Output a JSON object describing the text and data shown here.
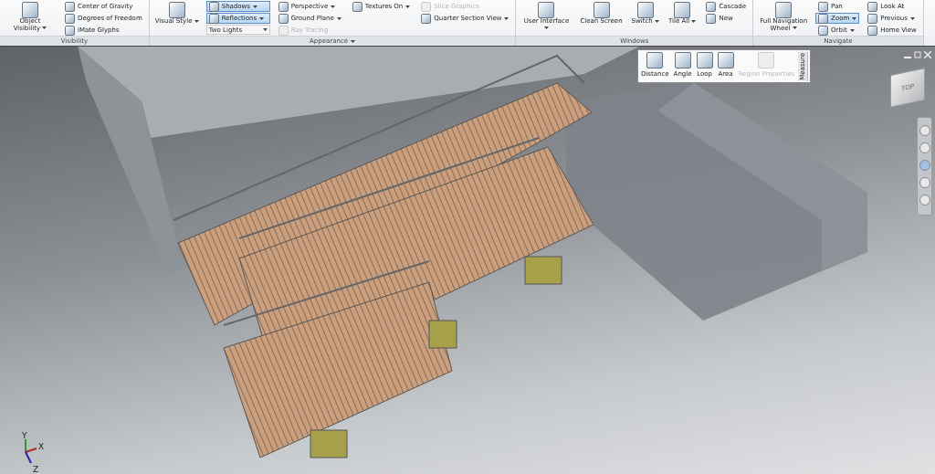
{
  "ribbon": {
    "panels": [
      {
        "label": "Visibility",
        "menu": false,
        "columns": [
          [
            {
              "kind": "large",
              "label": "Object Visibility",
              "menu": true,
              "selected": false,
              "disabled": false
            }
          ],
          [
            {
              "kind": "small",
              "label": "Center of Gravity",
              "menu": false,
              "selected": false,
              "disabled": false
            },
            {
              "kind": "small",
              "label": "Degrees of Freedom",
              "menu": false,
              "selected": false,
              "disabled": false
            },
            {
              "kind": "small",
              "label": "iMate Glyphs",
              "menu": false,
              "selected": false,
              "disabled": false
            }
          ]
        ]
      },
      {
        "label": "Appearance",
        "menu": true,
        "columns": [
          [
            {
              "kind": "large",
              "label": "Visual Style",
              "menu": true,
              "selected": false,
              "disabled": false
            }
          ],
          [
            {
              "kind": "small",
              "label": "Shadows",
              "menu": true,
              "selected": true,
              "disabled": false
            },
            {
              "kind": "small",
              "label": "Reflections",
              "menu": true,
              "selected": true,
              "disabled": false
            },
            {
              "kind": "combo",
              "label": "Two Lights",
              "menu": true
            }
          ],
          [
            {
              "kind": "small",
              "label": "Perspective",
              "menu": true,
              "selected": false,
              "disabled": false
            },
            {
              "kind": "small",
              "label": "Ground Plane",
              "menu": true,
              "selected": false,
              "disabled": false
            },
            {
              "kind": "small",
              "label": "Ray Tracing",
              "menu": false,
              "selected": false,
              "disabled": true
            }
          ],
          [
            {
              "kind": "small",
              "label": "Textures On",
              "menu": true,
              "selected": false,
              "disabled": false
            }
          ],
          [
            {
              "kind": "small",
              "label": "Slice Graphics",
              "menu": false,
              "selected": false,
              "disabled": true
            },
            {
              "kind": "small",
              "label": "Quarter Section View",
              "menu": true,
              "selected": false,
              "disabled": false
            }
          ]
        ]
      },
      {
        "label": "Windows",
        "menu": false,
        "columns": [
          [
            {
              "kind": "large",
              "label": "User Interface",
              "menu": true,
              "selected": false,
              "disabled": false
            }
          ],
          [
            {
              "kind": "large",
              "label": "Clean Screen",
              "menu": false,
              "selected": false,
              "disabled": false
            }
          ],
          [
            {
              "kind": "large",
              "label": "Switch",
              "menu": true,
              "selected": false,
              "disabled": false
            }
          ],
          [
            {
              "kind": "large",
              "label": "Tile All",
              "menu": true,
              "selected": false,
              "disabled": false
            }
          ],
          [
            {
              "kind": "small",
              "label": "Cascade",
              "menu": false,
              "selected": false,
              "disabled": false
            },
            {
              "kind": "small",
              "label": "New",
              "menu": false,
              "selected": false,
              "disabled": false
            }
          ]
        ]
      },
      {
        "label": "Navigate",
        "menu": false,
        "columns": [
          [
            {
              "kind": "large",
              "label": "Full Navigation Wheel",
              "menu": true,
              "selected": false,
              "disabled": false
            }
          ],
          [
            {
              "kind": "small",
              "label": "Pan",
              "menu": false,
              "selected": false,
              "disabled": false
            },
            {
              "kind": "small",
              "label": "Zoom",
              "menu": true,
              "selected": true,
              "disabled": false
            },
            {
              "kind": "small",
              "label": "Orbit",
              "menu": true,
              "selected": false,
              "disabled": false
            }
          ],
          [
            {
              "kind": "small",
              "label": "Look At",
              "menu": false,
              "selected": false,
              "disabled": false
            },
            {
              "kind": "small",
              "label": "Previous",
              "menu": true,
              "selected": false,
              "disabled": false
            },
            {
              "kind": "small",
              "label": "Home View",
              "menu": false,
              "selected": false,
              "disabled": false
            }
          ]
        ]
      }
    ]
  },
  "measure_toolbar": {
    "title": "Measure",
    "tools": [
      {
        "label": "Distance",
        "disabled": false
      },
      {
        "label": "Angle",
        "disabled": false
      },
      {
        "label": "Loop",
        "disabled": false
      },
      {
        "label": "Area",
        "disabled": false
      },
      {
        "label": "Region Properties",
        "disabled": true
      }
    ]
  },
  "viewcube": {
    "face": "TOP"
  },
  "axis_triad": {
    "x": "X",
    "y": "Y",
    "z": "Z"
  }
}
